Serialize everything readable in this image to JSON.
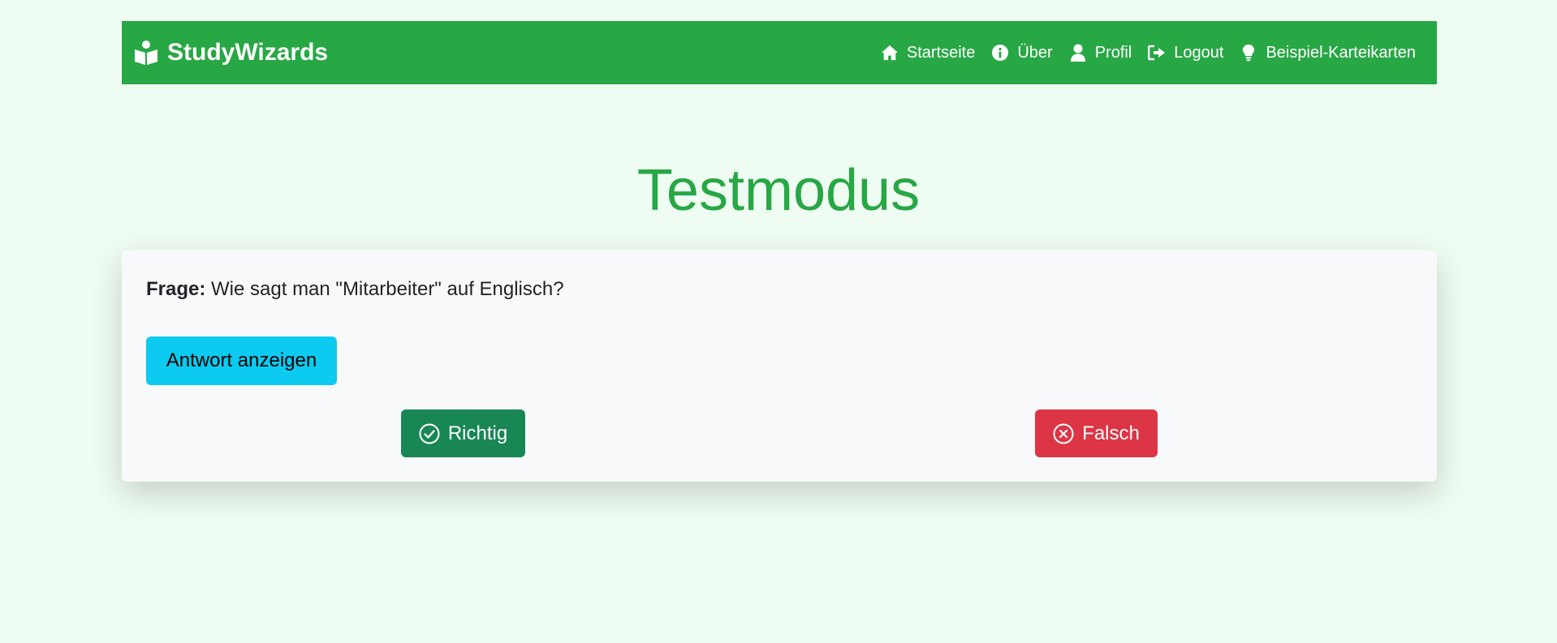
{
  "navbar": {
    "brand": "StudyWizards",
    "brand_icon": "book-reader-icon",
    "links": [
      {
        "label": "Startseite",
        "icon": "home-icon"
      },
      {
        "label": "Über",
        "icon": "info-circle-icon"
      },
      {
        "label": "Profil",
        "icon": "user-icon"
      },
      {
        "label": "Logout",
        "icon": "sign-out-icon"
      },
      {
        "label": "Beispiel-Karteikarten",
        "icon": "lightbulb-icon"
      }
    ],
    "color": "#28a745"
  },
  "page": {
    "title": "Testmodus"
  },
  "card": {
    "question_label": "Frage:",
    "question_text": "Wie sagt man \"Mitarbeiter\" auf Englisch?",
    "show_answer_button": "Antwort anzeigen",
    "correct_button": "Richtig",
    "correct_icon": "check-circle-icon",
    "wrong_button": "Falsch",
    "wrong_icon": "x-circle-icon"
  },
  "colors": {
    "background": "#effcf2",
    "accent": "#28a745",
    "info": "#0dcaf0",
    "success": "#198754",
    "danger": "#dc3545"
  }
}
